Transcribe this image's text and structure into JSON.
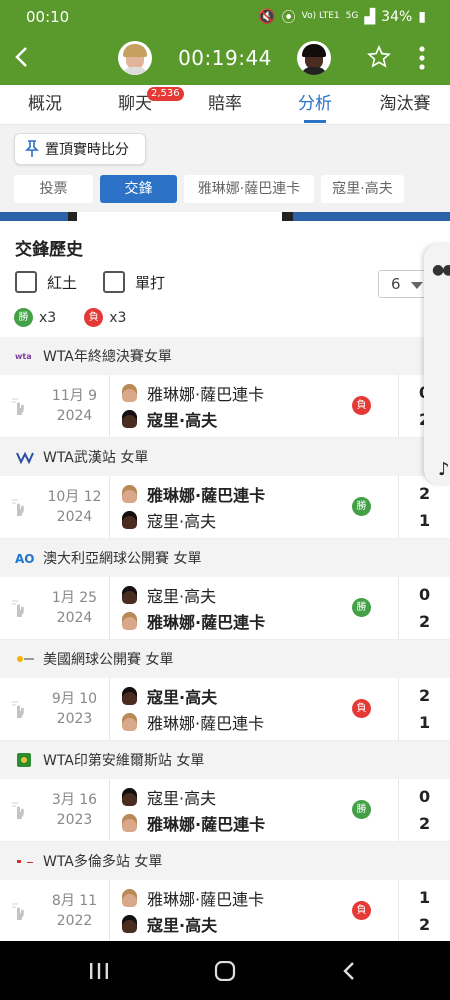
{
  "status": {
    "time": "00:10",
    "network": "Vo) LTE1",
    "net2": "5G",
    "battery": "34%"
  },
  "header": {
    "timer": "00:19:44"
  },
  "tabs": [
    {
      "label": "概況",
      "active": false
    },
    {
      "label": "聊天",
      "active": false,
      "badge": "2,536"
    },
    {
      "label": "賠率",
      "active": false
    },
    {
      "label": "分析",
      "active": true
    },
    {
      "label": "淘汰賽",
      "active": false
    }
  ],
  "pin_label": "置頂實時比分",
  "subtabs": [
    {
      "label": "投票",
      "active": false
    },
    {
      "label": "交鋒",
      "active": true
    },
    {
      "label": "雅琳娜·薩巴連卡",
      "active": false
    },
    {
      "label": "寇里·高夫",
      "active": false
    }
  ],
  "history": {
    "title": "交鋒歷史",
    "filters": [
      {
        "label": "紅土"
      },
      {
        "label": "單打"
      }
    ],
    "count_select": "6",
    "summary": {
      "win_mark": "勝",
      "win_count": "x3",
      "lose_mark": "負",
      "lose_count": "x3"
    }
  },
  "colors": {
    "accent": "#2c72c7",
    "header_green": "#5a9a2c",
    "win": "#43a047",
    "lose": "#e53935"
  },
  "matches": [
    {
      "tournament": "WTA年終總決賽女單",
      "logo": "wta-finals-logo",
      "month_day": "11月 9",
      "year": "2024",
      "p1": "雅琳娜·薩巴連卡",
      "p2": "寇里·高夫",
      "p1_avatar": "s",
      "p2_avatar": "g",
      "bold": 2,
      "result": "負",
      "outcome": "lose",
      "s1": "0",
      "s2": "2"
    },
    {
      "tournament": "WTA武漢站 女單",
      "logo": "wta-logo",
      "month_day": "10月 12",
      "year": "2024",
      "p1": "雅琳娜·薩巴連卡",
      "p2": "寇里·高夫",
      "p1_avatar": "s",
      "p2_avatar": "g",
      "bold": 1,
      "result": "勝",
      "outcome": "win",
      "s1": "2",
      "s2": "1"
    },
    {
      "tournament": "澳大利亞網球公開賽 女單",
      "logo": "ao-logo",
      "month_day": "1月 25",
      "year": "2024",
      "p1": "寇里·高夫",
      "p2": "雅琳娜·薩巴連卡",
      "p1_avatar": "g",
      "p2_avatar": "s",
      "bold": 2,
      "result": "勝",
      "outcome": "win",
      "s1": "0",
      "s2": "2"
    },
    {
      "tournament": "美國網球公開賽 女單",
      "logo": "us-open-logo",
      "month_day": "9月 10",
      "year": "2023",
      "p1": "寇里·高夫",
      "p2": "雅琳娜·薩巴連卡",
      "p1_avatar": "g",
      "p2_avatar": "s",
      "bold": 1,
      "result": "負",
      "outcome": "lose",
      "s1": "2",
      "s2": "1"
    },
    {
      "tournament": "WTA印第安維爾斯站 女單",
      "logo": "indian-wells-logo",
      "month_day": "3月 16",
      "year": "2023",
      "p1": "寇里·高夫",
      "p2": "雅琳娜·薩巴連卡",
      "p1_avatar": "g",
      "p2_avatar": "s",
      "bold": 2,
      "result": "勝",
      "outcome": "win",
      "s1": "0",
      "s2": "2"
    },
    {
      "tournament": "WTA多倫多站 女單",
      "logo": "toronto-logo",
      "month_day": "8月 11",
      "year": "2022",
      "p1": "雅琳娜·薩巴連卡",
      "p2": "寇里·高夫",
      "p1_avatar": "s",
      "p2_avatar": "g",
      "bold": 2,
      "result": "負",
      "outcome": "lose",
      "s1": "1",
      "s2": "2"
    }
  ]
}
